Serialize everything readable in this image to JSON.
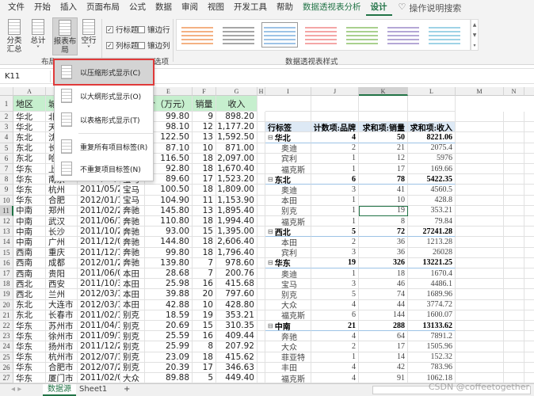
{
  "ribbon_tabs": [
    {
      "label": "文件"
    },
    {
      "label": "开始"
    },
    {
      "label": "插入"
    },
    {
      "label": "页面布局"
    },
    {
      "label": "公式"
    },
    {
      "label": "数据"
    },
    {
      "label": "审阅"
    },
    {
      "label": "视图"
    },
    {
      "label": "开发工具"
    },
    {
      "label": "帮助"
    },
    {
      "label": "数据透视表分析",
      "contextual": true
    },
    {
      "label": "设计",
      "active": true
    }
  ],
  "search": {
    "icon": "lightbulb-icon",
    "label": "操作说明搜索"
  },
  "ribbon": {
    "buttons": [
      {
        "label": "分类汇总",
        "sub": "总˅"
      },
      {
        "label": "总计",
        "sub": "˅"
      },
      {
        "label": "报表布局",
        "sub": "局˅",
        "pressed": true
      },
      {
        "label": "空行",
        "sub": "˅"
      }
    ],
    "layout_group": "布局",
    "options": [
      {
        "label": "行标题",
        "checked": true
      },
      {
        "label": "镶边行",
        "checked": false
      },
      {
        "label": "列标题",
        "checked": true
      },
      {
        "label": "镶边列",
        "checked": false
      }
    ],
    "options_group": "选项",
    "styles_group": "数据透视表样式",
    "style_colors": [
      "#f4b183",
      "#a6a6a6",
      "#9dc3e6",
      "#f4a6a6",
      "#a9d08e",
      "#b4a7d6",
      "#9fd3e6"
    ]
  },
  "menu": {
    "items": [
      {
        "label": "以压缩形式显示(C)",
        "highlighted": true
      },
      {
        "label": "以大纲形式显示(O)"
      },
      {
        "label": "以表格形式显示(T)"
      },
      {
        "label": "重复所有项目标签(R)"
      },
      {
        "label": "不重复项目标签(N)"
      }
    ]
  },
  "name_box": "K11",
  "columns": [
    "A",
    "B",
    "C",
    "D",
    "E",
    "F",
    "G",
    "H",
    "I",
    "J",
    "K",
    "L",
    "M",
    "N",
    "O"
  ],
  "selected_cell": "K11",
  "source_header": [
    "地区",
    "城",
    "",
    "",
    "价（万元）",
    "销量",
    "收入"
  ],
  "source_rows": [
    [
      "华北",
      "北",
      "",
      "",
      "99.80",
      "9",
      "898.20"
    ],
    [
      "华北",
      "天",
      "",
      "",
      "98.10",
      "12",
      "1,177.20"
    ],
    [
      "东北",
      "沈",
      "",
      "",
      "122.50",
      "13",
      "1,592.50"
    ],
    [
      "东北",
      "长",
      "",
      "",
      "87.10",
      "10",
      "871.00"
    ],
    [
      "东北",
      "哈",
      "",
      "",
      "116.50",
      "18",
      "2,097.00"
    ],
    [
      "华东",
      "上",
      "",
      "",
      "92.80",
      "18",
      "1,670.40"
    ],
    [
      "华东",
      "南京",
      "2011/04/29",
      "宝马",
      "89.60",
      "17",
      "1,523.20"
    ],
    [
      "华东",
      "杭州",
      "2011/05/24",
      "宝马",
      "100.50",
      "18",
      "1,809.00"
    ],
    [
      "华东",
      "合肥",
      "2012/01/13",
      "宝马",
      "104.90",
      "11",
      "1,153.90"
    ],
    [
      "中南",
      "郑州",
      "2011/02/26",
      "奔驰",
      "145.80",
      "13",
      "1,895.40"
    ],
    [
      "中南",
      "武汉",
      "2011/06/10",
      "奔驰",
      "110.80",
      "18",
      "1,994.40"
    ],
    [
      "中南",
      "长沙",
      "2011/10/26",
      "奔驰",
      "93.00",
      "15",
      "1,395.00"
    ],
    [
      "中南",
      "广州",
      "2011/12/06",
      "奔驰",
      "144.80",
      "18",
      "2,606.40"
    ],
    [
      "西南",
      "重庆",
      "2011/12/15",
      "奔驰",
      "99.80",
      "18",
      "1,796.40"
    ],
    [
      "西南",
      "成都",
      "2012/01/20",
      "奔驰",
      "139.80",
      "7",
      "978.60"
    ],
    [
      "西南",
      "贵阳",
      "2011/06/04",
      "本田",
      "28.68",
      "7",
      "200.76"
    ],
    [
      "西北",
      "西安",
      "2011/10/30",
      "本田",
      "25.98",
      "16",
      "415.68"
    ],
    [
      "西北",
      "兰州",
      "2012/03/10",
      "本田",
      "39.88",
      "20",
      "797.60"
    ],
    [
      "东北",
      "大连市",
      "2012/03/19",
      "本田",
      "42.88",
      "10",
      "428.80"
    ],
    [
      "东北",
      "长春市",
      "2011/02/12",
      "别克",
      "18.59",
      "19",
      "353.21"
    ],
    [
      "华东",
      "苏州市",
      "2011/04/16",
      "别克",
      "20.69",
      "15",
      "310.35"
    ],
    [
      "华东",
      "徐州市",
      "2011/09/11",
      "别克",
      "25.59",
      "16",
      "409.44"
    ],
    [
      "华东",
      "扬州市",
      "2011/12/24",
      "别克",
      "25.99",
      "8",
      "207.92"
    ],
    [
      "华东",
      "杭州市",
      "2012/07/15",
      "别克",
      "23.09",
      "18",
      "415.62"
    ],
    [
      "华东",
      "合肥市",
      "2012/07/29",
      "别克",
      "20.39",
      "17",
      "346.63"
    ],
    [
      "华东",
      "厦门市",
      "2011/02/08",
      "大众",
      "89.88",
      "5",
      "449.40"
    ]
  ],
  "pivot": {
    "header": [
      "行标签",
      "计数项:品牌",
      "求和项:销量",
      "求和项:收入"
    ],
    "rows": [
      {
        "label": "华北",
        "group": true,
        "values": [
          "4",
          "50",
          "8221.06"
        ]
      },
      {
        "label": "奥迪",
        "values": [
          "2",
          "21",
          "2075.4"
        ]
      },
      {
        "label": "宾利",
        "values": [
          "1",
          "12",
          "5976"
        ]
      },
      {
        "label": "福克斯",
        "values": [
          "1",
          "17",
          "169.66"
        ]
      },
      {
        "label": "东北",
        "group": true,
        "values": [
          "6",
          "78",
          "5422.35"
        ]
      },
      {
        "label": "奥迪",
        "values": [
          "3",
          "41",
          "4560.5"
        ]
      },
      {
        "label": "本田",
        "values": [
          "1",
          "10",
          "428.8"
        ]
      },
      {
        "label": "别克",
        "values": [
          "1",
          "19",
          "353.21"
        ]
      },
      {
        "label": "福克斯",
        "values": [
          "1",
          "8",
          "79.84"
        ]
      },
      {
        "label": "西北",
        "group": true,
        "values": [
          "5",
          "72",
          "27241.28"
        ]
      },
      {
        "label": "本田",
        "values": [
          "2",
          "36",
          "1213.28"
        ]
      },
      {
        "label": "宾利",
        "values": [
          "3",
          "36",
          "26028"
        ]
      },
      {
        "label": "华东",
        "group": true,
        "values": [
          "19",
          "326",
          "13221.25"
        ]
      },
      {
        "label": "奥迪",
        "values": [
          "1",
          "18",
          "1670.4"
        ]
      },
      {
        "label": "宝马",
        "values": [
          "3",
          "46",
          "4486.1"
        ]
      },
      {
        "label": "别克",
        "values": [
          "5",
          "74",
          "1689.96"
        ]
      },
      {
        "label": "大众",
        "values": [
          "4",
          "44",
          "3774.72"
        ]
      },
      {
        "label": "福克斯",
        "values": [
          "6",
          "144",
          "1600.07"
        ]
      },
      {
        "label": "中南",
        "group": true,
        "values": [
          "21",
          "288",
          "13133.62"
        ]
      },
      {
        "label": "奔驰",
        "values": [
          "4",
          "64",
          "7891.2"
        ]
      },
      {
        "label": "大众",
        "values": [
          "2",
          "17",
          "1505.96"
        ]
      },
      {
        "label": "菲亚特",
        "values": [
          "1",
          "14",
          "152.32"
        ]
      },
      {
        "label": "丰田",
        "values": [
          "4",
          "42",
          "783.96"
        ]
      },
      {
        "label": "福克斯",
        "values": [
          "4",
          "91",
          "1062.18"
        ]
      }
    ]
  },
  "sheet_tabs": [
    {
      "label": "数据源",
      "active": true
    },
    {
      "label": "Sheet1"
    }
  ],
  "add_sheet": "+",
  "watermark": "CSDN @coffeetogether",
  "colors": {
    "accent": "#217346",
    "header_fill": "#c6efce",
    "pivot_header": "#dde9f5",
    "highlight_border": "#e03a3a"
  }
}
